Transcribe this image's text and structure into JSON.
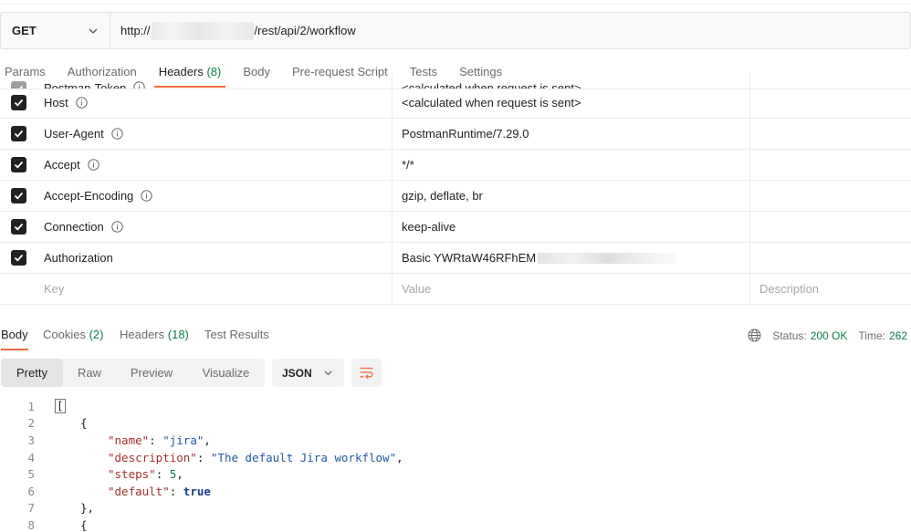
{
  "request": {
    "method": "GET",
    "url_prefix": "http://",
    "url_suffix": "/rest/api/2/workflow"
  },
  "request_tabs": [
    {
      "label": "Params"
    },
    {
      "label": "Authorization"
    },
    {
      "label": "Headers",
      "count": "(8)",
      "active": true
    },
    {
      "label": "Body"
    },
    {
      "label": "Pre-request Script"
    },
    {
      "label": "Tests"
    },
    {
      "label": "Settings"
    }
  ],
  "headers": {
    "rows": [
      {
        "key": "Postman-Token",
        "value": "<calculated when request is sent>",
        "checked": true,
        "info": true
      },
      {
        "key": "Host",
        "value": "<calculated when request is sent>",
        "checked": true,
        "info": true
      },
      {
        "key": "User-Agent",
        "value": "PostmanRuntime/7.29.0",
        "checked": true,
        "info": true
      },
      {
        "key": "Accept",
        "value": "*/*",
        "checked": true,
        "info": true
      },
      {
        "key": "Accept-Encoding",
        "value": "gzip, deflate, br",
        "checked": true,
        "info": true
      },
      {
        "key": "Connection",
        "value": "keep-alive",
        "checked": true,
        "info": true
      },
      {
        "key": "Authorization",
        "value": "Basic YWRtaW46RFhEM",
        "checked": true,
        "info": false
      }
    ],
    "placeholder": {
      "key": "Key",
      "value": "Value",
      "description": "Description"
    }
  },
  "response_tabs": [
    {
      "label": "Body",
      "active": true
    },
    {
      "label": "Cookies",
      "count": "(2)"
    },
    {
      "label": "Headers",
      "count": "(18)"
    },
    {
      "label": "Test Results"
    }
  ],
  "status": {
    "status_label": "Status:",
    "status_value": "200 OK",
    "time_label": "Time:",
    "time_value": "262"
  },
  "view_modes": [
    {
      "label": "Pretty",
      "active": true
    },
    {
      "label": "Raw"
    },
    {
      "label": "Preview"
    },
    {
      "label": "Visualize"
    }
  ],
  "format": "JSON",
  "code": {
    "line_numbers": [
      "1",
      "2",
      "3",
      "4",
      "5",
      "6",
      "7",
      "8"
    ],
    "open_bracket": "[",
    "open_brace": "{",
    "name_key": "\"name\"",
    "name_val": "\"jira\"",
    "desc_key": "\"description\"",
    "desc_val": "\"The default Jira workflow\"",
    "steps_key": "\"steps\"",
    "steps_val": "5",
    "default_key": "\"default\"",
    "default_val": "true",
    "close_brace": "},",
    "open_brace2": "{"
  },
  "colors": {
    "accent": "#f26b3a",
    "count_green": "#0c7d46",
    "json_key": "#a3302e",
    "json_string": "#2158a0"
  }
}
